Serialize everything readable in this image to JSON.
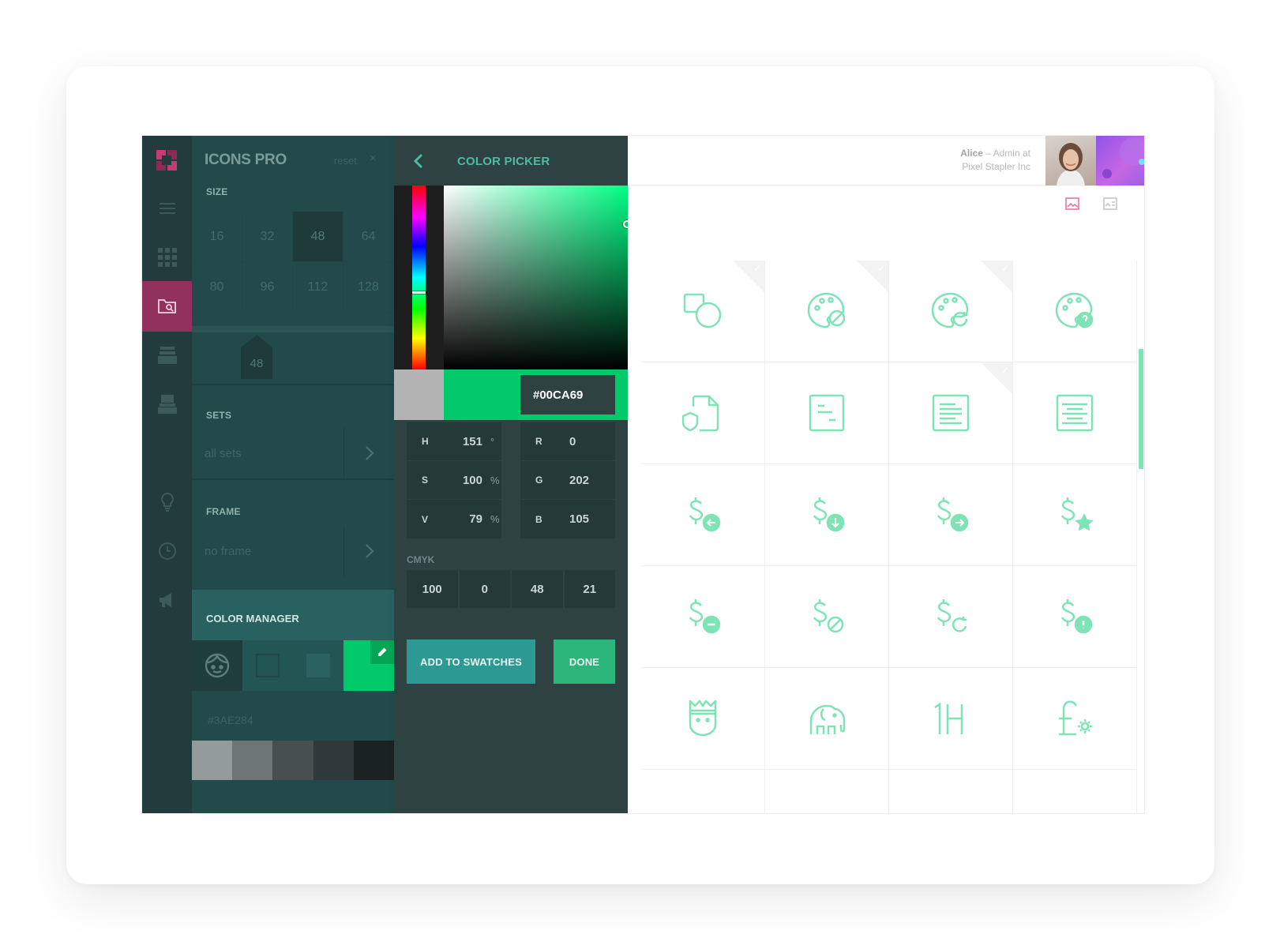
{
  "options": {
    "title": "ICONS PRO",
    "reset_label": "reset",
    "close_glyph": "×",
    "size_label": "SIZE",
    "sizes": [
      "16",
      "32",
      "48",
      "64",
      "80",
      "96",
      "112",
      "128"
    ],
    "selected_size": "48",
    "slider_value": "48",
    "sets_label": "SETS",
    "sets_value": "all sets",
    "frame_label": "FRAME",
    "frame_value": "no frame",
    "color_manager_label": "COLOR MANAGER",
    "active_color_hex": "#3AE284",
    "swatch_colors": [
      "#939c9a",
      "#6c7574",
      "#474f4f",
      "#303939",
      "#1a2222"
    ]
  },
  "picker": {
    "title": "COLOR PICKER",
    "hex": "#00CA69",
    "previous_color": "#b3b3b3",
    "current_color": "#00ca69",
    "hsv": [
      {
        "label": "H",
        "value": "151",
        "unit": "°"
      },
      {
        "label": "S",
        "value": "100",
        "unit": "%"
      },
      {
        "label": "V",
        "value": "79",
        "unit": "%"
      }
    ],
    "rgb": [
      {
        "label": "R",
        "value": "0"
      },
      {
        "label": "G",
        "value": "202"
      },
      {
        "label": "B",
        "value": "105"
      }
    ],
    "cmyk_label": "CMYK",
    "cmyk": [
      "100",
      "0",
      "48",
      "21"
    ],
    "add_button": "ADD TO SWATCHES",
    "done_button": "DONE"
  },
  "user": {
    "name": "Alice",
    "role_line1": " – Admin at",
    "role_line2": "Pixel Stapler Inc"
  },
  "nav_icons": [
    "menu-icon",
    "grid-icon",
    "folder-search-icon",
    "inbox-icon",
    "stack-icon",
    "lightbulb-icon",
    "clock-icon",
    "megaphone-icon"
  ],
  "icon_grid": [
    "shapes-icon",
    "palette-blocked-icon",
    "palette-refresh-icon",
    "palette-help-icon",
    "file-shield-icon",
    "document-brief-icon",
    "document-lines-icon",
    "document-center-icon",
    "dollar-back-icon",
    "dollar-download-icon",
    "dollar-forward-icon",
    "dollar-star-icon",
    "dollar-minus-icon",
    "dollar-blocked-icon",
    "dollar-refresh-icon",
    "dollar-alert-icon",
    "crown-face-icon",
    "elephant-icon",
    "hashtag-1h-icon",
    "pound-gear-icon",
    "currency-partial-icon",
    "currency-partial-icon",
    "currency-partial-icon",
    "currency-partial-icon"
  ],
  "colors": {
    "accent": "#00ca69",
    "icon_stroke": "#7ee3b5",
    "rail_active": "#92305e"
  }
}
